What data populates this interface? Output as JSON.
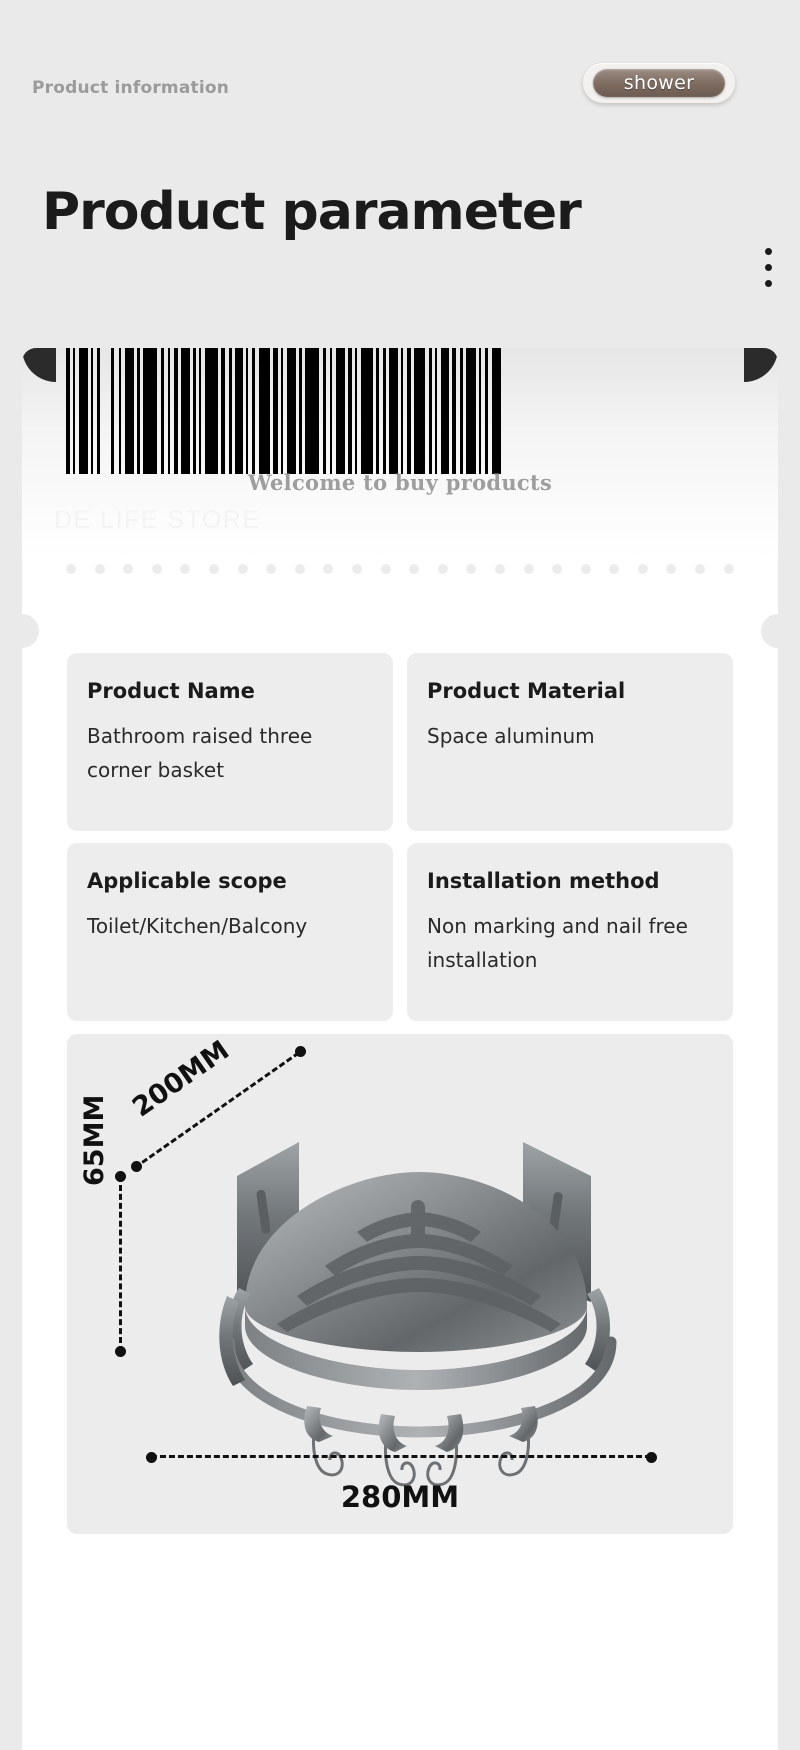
{
  "header": {
    "kicker": "Product information",
    "badge_label": "shower",
    "badge_color": "#7d6b60"
  },
  "title": "Product parameter",
  "menu": {
    "name": "more-options",
    "dots": 3
  },
  "ticket": {
    "welcome_text": "Welcome to buy products",
    "watermark": "DE LIFE STORE",
    "barcode_alt": "barcode"
  },
  "specs": [
    {
      "label": "Product Name",
      "value": "Bathroom raised three corner basket"
    },
    {
      "label": "Product Material",
      "value": "Space aluminum"
    },
    {
      "label": "Applicable scope",
      "value": "Toilet/Kitchen/Balcony"
    },
    {
      "label": "Installation method",
      "value": "Non marking and nail free installation"
    }
  ],
  "dimensions": {
    "depth": "200MM",
    "height": "65MM",
    "width": "280MM"
  }
}
